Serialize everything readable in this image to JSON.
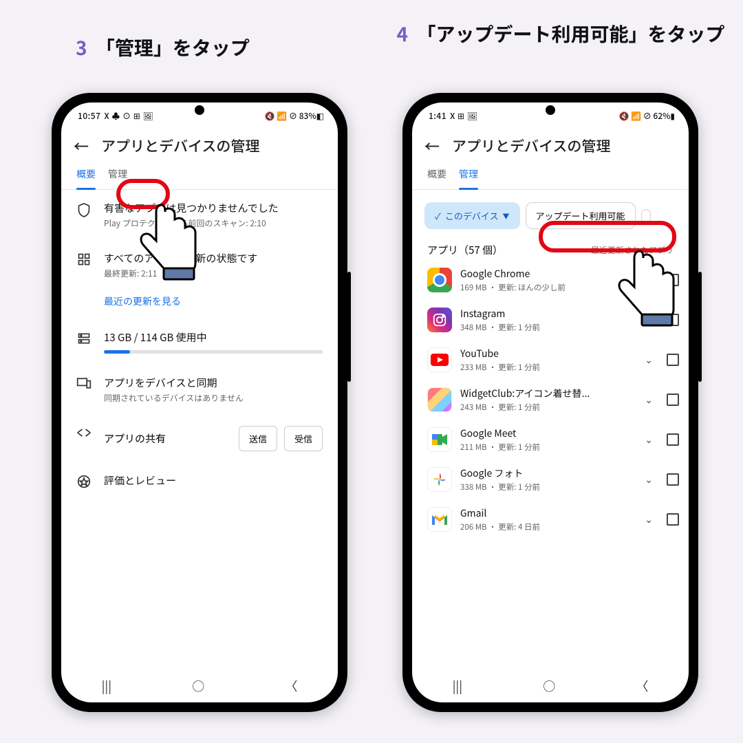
{
  "captions": {
    "left": {
      "num": "3",
      "text": "「管理」をタップ"
    },
    "right": {
      "num": "4",
      "text": "「アップデート利用可能」をタップ"
    }
  },
  "left": {
    "status": {
      "time": "10:57",
      "icons": "X ♣ ⊙ ⊞ 🖼",
      "right": "🔇 📶 ⊘ 83%◧"
    },
    "title": "アプリとデバイスの管理",
    "tabs": {
      "overview": "概要",
      "manage": "管理"
    },
    "shield": {
      "t1": "有害なアプリは見つかりませんでした",
      "t2": "Play プロテクトによる前回のスキャン: 2:10"
    },
    "apps": {
      "t1": "すべてのアプリは最新の状態です",
      "t2": "最終更新: 2:11"
    },
    "link": "最近の更新を見る",
    "storage": {
      "t1": "13 GB / 114 GB 使用中"
    },
    "sync": {
      "t1": "アプリをデバイスと同期",
      "t2": "同期されているデバイスはありません"
    },
    "share": {
      "label": "アプリの共有",
      "send": "送信",
      "recv": "受信"
    },
    "review": "評価とレビュー",
    "nav": {
      "a": "|||",
      "b": "○",
      "c": "〈"
    }
  },
  "right": {
    "status": {
      "time": "1:41",
      "icons": "X ⊞ 🖼",
      "right": "🔇 📶 ⊘ 62%▮"
    },
    "title": "アプリとデバイスの管理",
    "tabs": {
      "overview": "概要",
      "manage": "管理"
    },
    "chips": {
      "device": "このデバイス",
      "update": "アップデート利用可能"
    },
    "listhead": {
      "label": "アプリ（57 個）",
      "sort": "最近更新されたアプリ"
    },
    "apps": [
      {
        "name": "Google Chrome",
        "sub": "169 MB ・ 更新: ほんの少し前",
        "icon": "ic-chrome"
      },
      {
        "name": "Instagram",
        "sub": "348 MB ・ 更新: 1 分前",
        "icon": "ic-ig"
      },
      {
        "name": "YouTube",
        "sub": "233 MB ・ 更新: 1 分前",
        "icon": "ic-yt"
      },
      {
        "name": "WidgetClub:アイコン着せ替...",
        "sub": "243 MB ・ 更新: 1 分前",
        "icon": "ic-wc"
      },
      {
        "name": "Google Meet",
        "sub": "211 MB ・ 更新: 1 分前",
        "icon": "ic-meet"
      },
      {
        "name": "Google フォト",
        "sub": "338 MB ・ 更新: 1 分前",
        "icon": "ic-photos"
      },
      {
        "name": "Gmail",
        "sub": "206 MB ・ 更新: 4 日前",
        "icon": "ic-gmail"
      }
    ],
    "nav": {
      "a": "|||",
      "b": "○",
      "c": "〈"
    }
  }
}
